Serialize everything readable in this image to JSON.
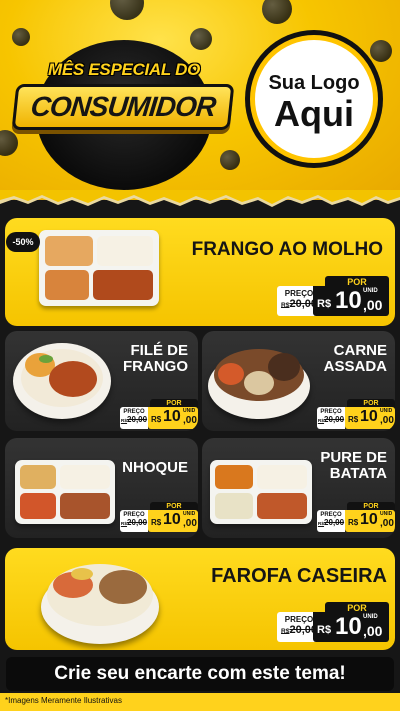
{
  "header": {
    "badge_top": "MÊS ESPECIAL DO",
    "badge_main": "CONSUMIDOR",
    "logo_line1": "Sua Logo",
    "logo_line2": "Aqui"
  },
  "products": [
    {
      "title": "FRANGO AO MOLHO",
      "badge": "-50%",
      "por": "POR",
      "preco": "PREÇO",
      "old_cur": "R$",
      "old_price": "20,00",
      "cur": "R$",
      "price_int": "10",
      "price_dec": ",00",
      "unit": "UNID"
    },
    {
      "title_l1": "FILÉ DE",
      "title_l2": "FRANGO",
      "por": "POR",
      "preco": "PREÇO",
      "old_cur": "R$",
      "old_price": "20,00",
      "cur": "R$",
      "price_int": "10",
      "price_dec": ",00",
      "unit": "UNID"
    },
    {
      "title_l1": "CARNE",
      "title_l2": "ASSADA",
      "por": "POR",
      "preco": "PREÇO",
      "old_cur": "R$",
      "old_price": "20,00",
      "cur": "R$",
      "price_int": "10",
      "price_dec": ",00",
      "unit": "UNID"
    },
    {
      "title": "NHOQUE",
      "por": "POR",
      "preco": "PREÇO",
      "old_cur": "R$",
      "old_price": "20,00",
      "cur": "R$",
      "price_int": "10",
      "price_dec": ",00",
      "unit": "UNID"
    },
    {
      "title_l1": "PURE DE",
      "title_l2": "BATATA",
      "por": "POR",
      "preco": "PREÇO",
      "old_cur": "R$",
      "old_price": "20,00",
      "cur": "R$",
      "price_int": "10",
      "price_dec": ",00",
      "unit": "UNID"
    },
    {
      "title": "FAROFA CASEIRA",
      "por": "POR",
      "preco": "PREÇO",
      "old_cur": "R$",
      "old_price": "20,00",
      "cur": "R$",
      "price_int": "10",
      "price_dec": ",00",
      "unit": "UNID"
    }
  ],
  "cta": "Crie seu encarte com este tema!",
  "footnote": "*Imagens Meramente Ilustrativas",
  "colors": {
    "yellow": "#ffd21c",
    "dark": "#111111",
    "card_dark": "#2b2b2b"
  }
}
